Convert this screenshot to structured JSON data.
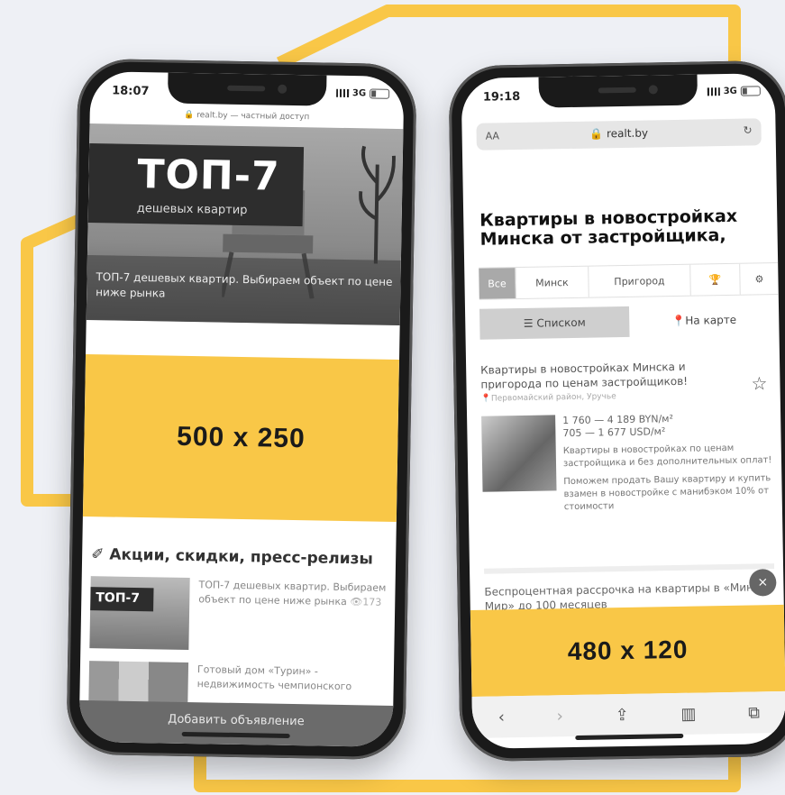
{
  "phone_left": {
    "status": {
      "time": "18:07",
      "network": "3G"
    },
    "url_host": "realt.by",
    "url_suffix": "— частный доступ",
    "hero": {
      "headline": "ТОП-7",
      "subheadline": "дешевых квартир",
      "caption": "ТОП-7 дешевых квартир. Выбираем объект по цене ниже рынка"
    },
    "ad_label": "500 x 250",
    "section_title": "Акции, скидки, пресс-релизы",
    "news": [
      {
        "thumb_label": "ТОП-7",
        "text": "ТОП-7 дешевых квартир. Выбираем объект по цене ниже рынка",
        "views": "173"
      },
      {
        "thumb_label": "",
        "text": "Готовый дом «Турин» - недвижимость чемпионского",
        "views": ""
      }
    ],
    "add_button": "Добавить объявление"
  },
  "phone_right": {
    "status": {
      "time": "19:18",
      "network": "3G"
    },
    "url": {
      "aa": "AA",
      "host": "realt.by"
    },
    "title": "Квартиры в новостройках Минска от застройщика,",
    "filters": [
      "Все",
      "Минск",
      "Пригород"
    ],
    "views": [
      "Списком",
      "На карте"
    ],
    "listing": {
      "title": "Квартиры в новостройках Минска и пригорода по ценам застройщиков!",
      "location": "Первомайский район, Уручье",
      "price_byn": "1 760 — 4 189 BYN/м²",
      "price_usd": "705 — 1 677 USD/м²",
      "desc1": "Квартиры в новостройках по ценам застройщика и без дополнительных оплат!",
      "desc2": "Поможем продать Вашу квартиру и купить взамен в новостройке с манибэком 10% от стоимости"
    },
    "listing2_title": "Беспроцентная рассрочка на квартиры в «Минск Мир» до 100 месяцев",
    "ad_label": "480 x 120",
    "close_label": "×"
  },
  "colors": {
    "accent": "#f9c747",
    "background": "#eef0f5"
  }
}
